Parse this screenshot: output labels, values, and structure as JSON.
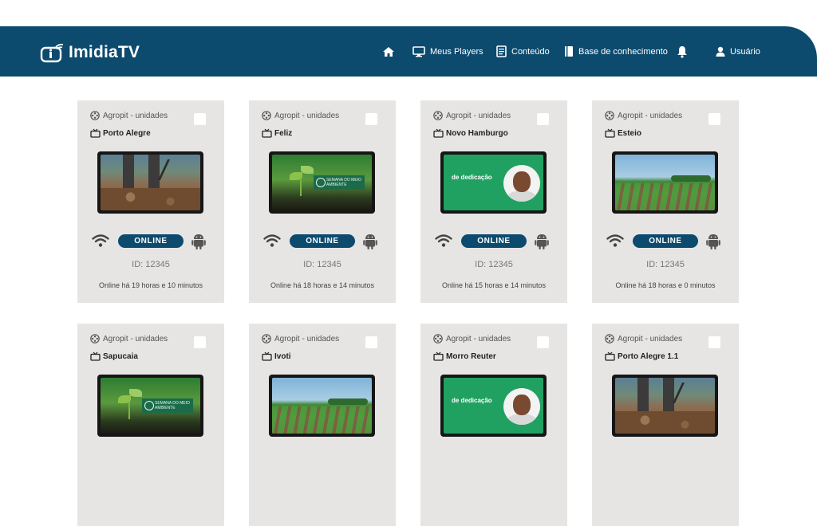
{
  "app": {
    "logo_text": "ImidiaTV"
  },
  "nav": {
    "home_label": "",
    "players_label": "Meus Players",
    "content_label": "Conteúdo",
    "knowledge_label": "Base de conhecimento",
    "user_label": "Usuário"
  },
  "colors": {
    "brand": "#0c4a6e",
    "card_bg": "#e6e5e3"
  },
  "players": [
    {
      "group": "Agropit - unidades",
      "name": "Porto Alegre",
      "thumbnail": "soil",
      "status": "ONLINE",
      "id": "ID: 12345",
      "online_text": "Online há 19 horas e 10 minutos"
    },
    {
      "group": "Agropit - unidades",
      "name": "Feliz",
      "thumbnail": "sprout",
      "thumbnail_text": "SEMANA DO MEIO AMBIENTE",
      "status": "ONLINE",
      "id": "ID: 12345",
      "online_text": "Online há 18 horas e 14 minutos"
    },
    {
      "group": "Agropit - unidades",
      "name": "Novo Hamburgo",
      "thumbnail": "person",
      "thumbnail_title": "de dedicação",
      "status": "ONLINE",
      "id": "ID: 12345",
      "online_text": "Online há 15 horas e 14 minutos"
    },
    {
      "group": "Agropit - unidades",
      "name": "Esteio",
      "thumbnail": "field",
      "status": "ONLINE",
      "id": "ID: 12345",
      "online_text": "Online há 18 horas e 0 minutos"
    },
    {
      "group": "Agropit - unidades",
      "name": "Sapucaia",
      "thumbnail": "sprout",
      "thumbnail_text": "SEMANA DO MEIO AMBIENTE"
    },
    {
      "group": "Agropit - unidades",
      "name": "Ivoti",
      "thumbnail": "field"
    },
    {
      "group": "Agropit - unidades",
      "name": "Morro Reuter",
      "thumbnail": "person",
      "thumbnail_title": "de dedicação"
    },
    {
      "group": "Agropit - unidades",
      "name": "Porto Alegre 1.1",
      "thumbnail": "soil"
    }
  ]
}
